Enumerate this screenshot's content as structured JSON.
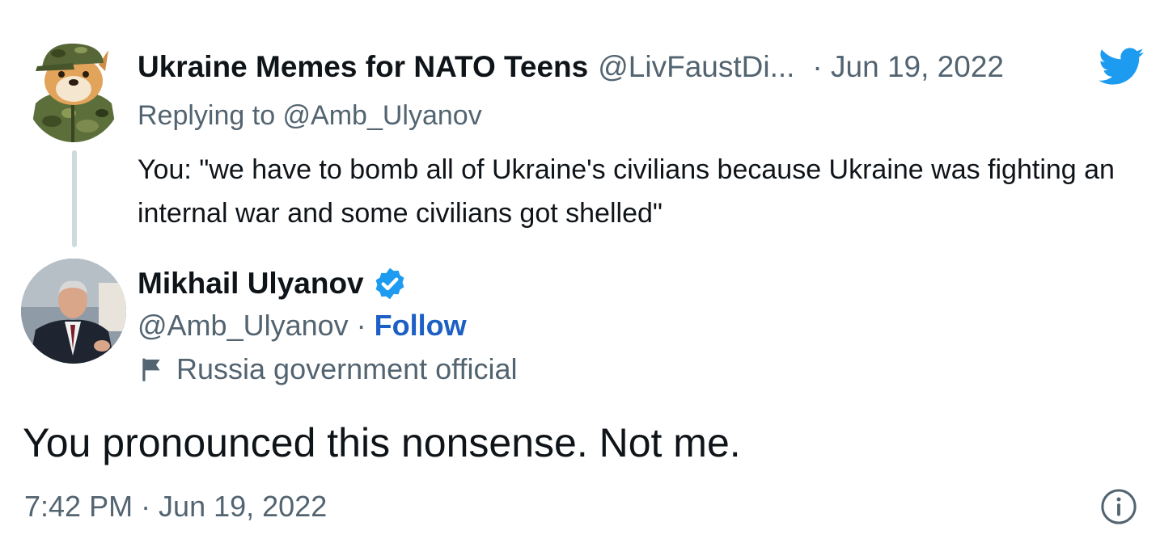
{
  "parent_tweet": {
    "display_name": "Ukraine Memes for NATO Teens",
    "handle": "@LivFaustDi...",
    "separator": "·",
    "date": "Jun 19, 2022",
    "replying_label": "Replying to ",
    "replying_handle": "@Amb_Ulyanov",
    "text": "You: \"we have to bomb all of Ukraine's civilians because Ukraine was fighting an internal war and some civilians got shelled\"",
    "avatar_icon": "shiba-dog-camo-avatar"
  },
  "main_tweet": {
    "display_name": "Mikhail Ulyanov",
    "verified_icon": "verified-badge-icon",
    "handle": "@Amb_Ulyanov",
    "separator": " · ",
    "follow_label": "Follow",
    "gov_label": "Russia government official",
    "text": "You pronounced this nonsense. Not me.",
    "timestamp": "7:42 PM · Jun 19, 2022",
    "avatar_icon": "man-in-suit-avatar"
  },
  "icons": {
    "brand": "twitter-bird-icon",
    "info": "info-icon",
    "flag": "flag-icon"
  },
  "colors": {
    "brand_blue": "#1d9bf0",
    "follow_blue": "#1d5fc4",
    "secondary_text": "#536471",
    "primary_text": "#0f1419",
    "thread_line": "#cfd9de"
  }
}
